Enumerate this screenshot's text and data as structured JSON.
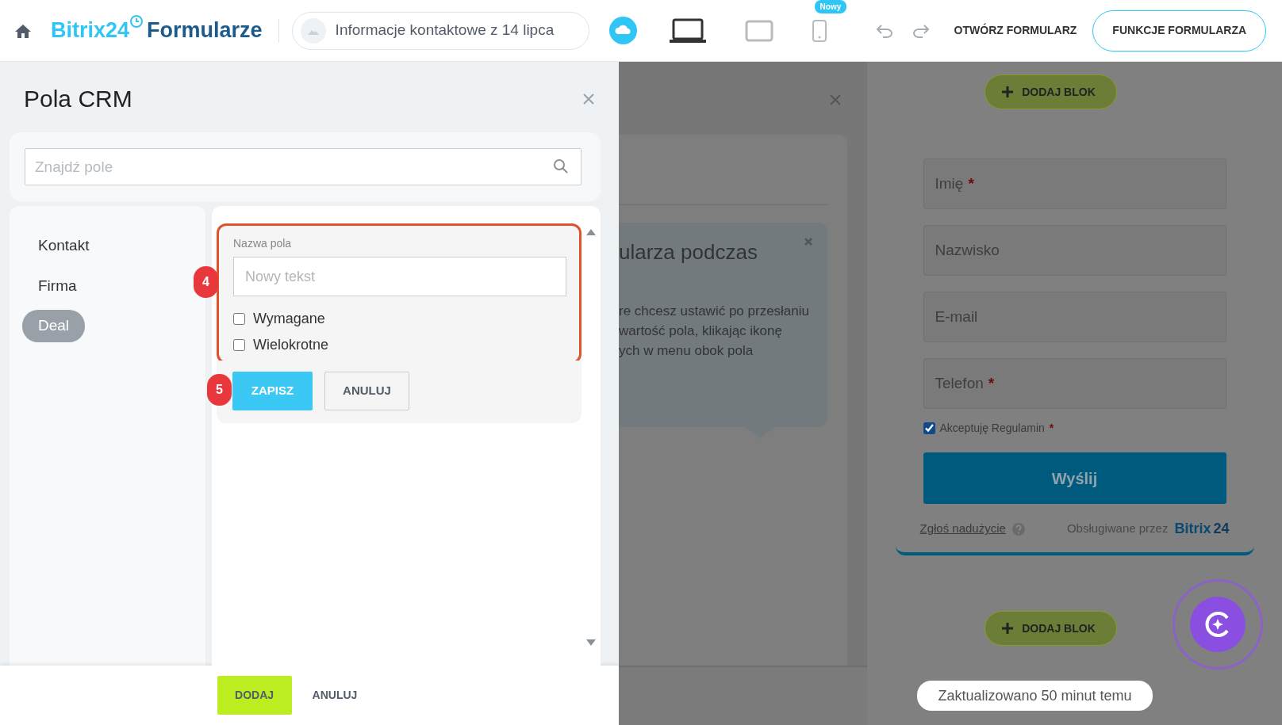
{
  "topbar": {
    "logo_brand": "Bitrix24",
    "logo_product": "Formularze",
    "form_name": "Informacje kontaktowe z 14 lipca",
    "devices": [
      {
        "kind": "desktop",
        "selected": true
      },
      {
        "kind": "tablet",
        "selected": false
      },
      {
        "kind": "phone",
        "selected": false,
        "badge": "Nowy"
      }
    ],
    "open_form": "OTWÓRZ FORMULARZ",
    "form_features": "FUNKCJE FORMULARZA"
  },
  "crm_panel": {
    "title": "Pola CRM",
    "search_placeholder": "Znajdź pole",
    "categories": [
      {
        "label": "Kontakt",
        "selected": false
      },
      {
        "label": "Firma",
        "selected": false
      },
      {
        "label": "Deal",
        "selected": true
      }
    ],
    "new_field": {
      "label": "Nazwa pola",
      "placeholder": "Nowy tekst",
      "options": [
        {
          "label": "Wymagane",
          "checked": false
        },
        {
          "label": "Wielokrotne",
          "checked": false
        }
      ],
      "save": "ZAPISZ",
      "cancel": "ANULUJ"
    },
    "step_markers": [
      "4",
      "5"
    ],
    "add": "DODAJ",
    "cancel": "ANULUJ"
  },
  "hint": {
    "heading": "ularza podczas",
    "lines": [
      "re chcesz ustawić po przesłaniu",
      "wartość pola, klikając ikonę",
      "ych w menu obok pola"
    ]
  },
  "preview": {
    "add_block_top": "DODAJ BLOK",
    "fields": [
      {
        "label": "Imię",
        "required_mark": "*"
      },
      {
        "label": "Nazwisko"
      },
      {
        "label": "E-mail"
      },
      {
        "label": "Telefon",
        "required_mark": "*"
      }
    ],
    "consent": {
      "label": "Akceptuję Regulamin",
      "checked": true,
      "required_mark": "*"
    },
    "submit": "Wyślij",
    "report": "Zgłoś nadużycie",
    "powered_by": "Obsługiwane przez",
    "brand": "Bitrix",
    "brand_num": "24",
    "add_block_bottom": "DODAJ BLOK"
  },
  "status": "Zaktualizowano 50 minut temu"
}
